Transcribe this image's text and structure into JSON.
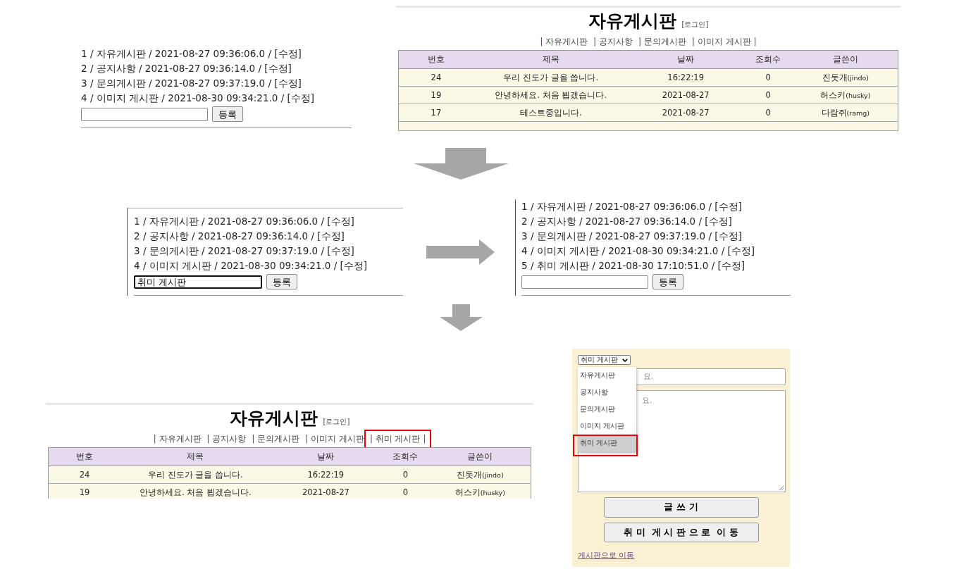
{
  "boards": [
    {
      "title": "자유게시판",
      "login_link": "[로그인]",
      "separator": "|",
      "nav": [
        {
          "label": "자유게시판",
          "highlighted": false
        },
        {
          "label": "공지사항",
          "highlighted": false
        },
        {
          "label": "문의게시판",
          "highlighted": false
        },
        {
          "label": "이미지 게시판",
          "highlighted": false
        }
      ],
      "columns": [
        "번호",
        "제목",
        "날짜",
        "조회수",
        "글쓴이"
      ],
      "rows": [
        {
          "no": "24",
          "title": "우리 진도가 글을 씁니다.",
          "date": "16:22:19",
          "views": "0",
          "author": "진돗개",
          "author_id": "(jindo)"
        },
        {
          "no": "19",
          "title": "안녕하세요. 처음 뵙겠습니다.",
          "date": "2021-08-27",
          "views": "0",
          "author": "허스키",
          "author_id": "(husky)"
        },
        {
          "no": "17",
          "title": "테스트중입니다.",
          "date": "2021-08-27",
          "views": "0",
          "author": "다람쥐",
          "author_id": "(ramg)"
        }
      ]
    },
    {
      "title": "자유게시판",
      "login_link": "[로그인]",
      "separator": "|",
      "nav": [
        {
          "label": "자유게시판",
          "highlighted": false
        },
        {
          "label": "공지사항",
          "highlighted": false
        },
        {
          "label": "문의게시판",
          "highlighted": false
        },
        {
          "label": "이미지 게시판",
          "highlighted": false
        },
        {
          "label": "취미 게시판",
          "highlighted": true
        }
      ],
      "columns": [
        "번호",
        "제목",
        "날짜",
        "조회수",
        "글쓴이"
      ],
      "rows": [
        {
          "no": "24",
          "title": "우리 진도가 글을 씁니다.",
          "date": "16:22:19",
          "views": "0",
          "author": "진돗개",
          "author_id": "(jindo)"
        },
        {
          "no": "19",
          "title": "안녕하세요. 처음 뵙겠습니다.",
          "date": "2021-08-27",
          "views": "0",
          "author": "허스키",
          "author_id": "(husky)"
        }
      ]
    }
  ],
  "category_lists": [
    {
      "entries": [
        "1 / 자유게시판 / 2021-08-27 09:36:06.0 / [수정]",
        "2 / 공지사항 / 2021-08-27 09:36:14.0 / [수정]",
        "3 / 문의게시판 / 2021-08-27 09:37:19.0 / [수정]",
        "4 / 이미지 게시판 / 2021-08-30 09:34:21.0 / [수정]"
      ],
      "focused": false,
      "button": "등록"
    },
    {
      "entries": [
        "1 / 자유게시판 / 2021-08-27 09:36:06.0 / [수정]",
        "2 / 공지사항 / 2021-08-27 09:36:14.0 / [수정]",
        "3 / 문의게시판 / 2021-08-27 09:37:19.0 / [수정]",
        "4 / 이미지 게시판 / 2021-08-30 09:34:21.0 / [수정]"
      ],
      "input_value": "취미 게시판",
      "focused": true,
      "button": "등록"
    },
    {
      "entries": [
        "1 / 자유게시판 / 2021-08-27 09:36:06.0 / [수정]",
        "2 / 공지사항 / 2021-08-27 09:36:14.0 / [수정]",
        "3 / 문의게시판 / 2021-08-27 09:37:19.0 / [수정]",
        "4 / 이미지 게시판 / 2021-08-30 09:34:21.0 / [수정]",
        "5 / 취미 게시판 / 2021-08-30 17:10:51.0 / [수정]"
      ],
      "focused": false,
      "button": "등록"
    }
  ],
  "write_form": {
    "select_value": "취미 게시판",
    "options": [
      {
        "label": "자유게시판",
        "selected": false,
        "highlighted": false
      },
      {
        "label": "공지사항",
        "selected": false,
        "highlighted": false
      },
      {
        "label": "문의게시판",
        "selected": false,
        "highlighted": false
      },
      {
        "label": "이미지 게시판",
        "selected": false,
        "highlighted": false
      },
      {
        "label": "취미 게시판",
        "selected": true,
        "highlighted": true
      }
    ],
    "title_placeholder": "요.",
    "content_placeholder": "요.",
    "submit_button": "글 쓰 기",
    "move_button": "취 미  게 시 판 으 로  이 동",
    "back_link": "게시판으로 이동"
  }
}
